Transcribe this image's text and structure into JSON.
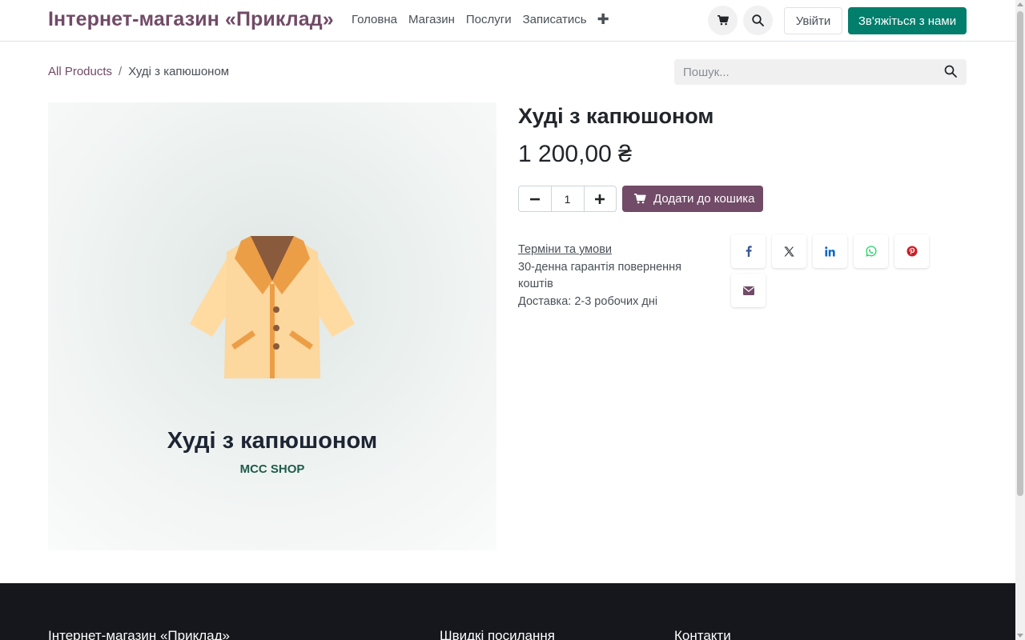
{
  "header": {
    "brand": "Інтернет-магазин «Приклад»",
    "nav": [
      {
        "label": "Головна"
      },
      {
        "label": "Магазин"
      },
      {
        "label": "Послуги"
      },
      {
        "label": "Записатись"
      }
    ],
    "nav_more_icon": "plus-icon",
    "cart_icon": "cart-icon",
    "search_icon": "search-icon",
    "login_label": "Увійти",
    "contact_label": "Зв'яжіться з нами"
  },
  "breadcrumb": {
    "root": "All Products",
    "separator": "/",
    "current": "Худі з капюшоном"
  },
  "search": {
    "placeholder": "Пошук...",
    "value": ""
  },
  "product": {
    "title": "Худі з капюшоном",
    "price": "1 200,00 ₴",
    "quantity": "1",
    "add_to_cart_label": "Додати до кошика",
    "image": {
      "title": "Худі з капюшоном",
      "subtitle": "MCC SHOP"
    },
    "info": {
      "terms": "Терміни та умови",
      "guarantee": "30-денна гарантія повернення коштів",
      "delivery": "Доставка: 2-3 робочих дні"
    },
    "share": [
      "facebook-icon",
      "x-icon",
      "linkedin-icon",
      "whatsapp-icon",
      "pinterest-icon",
      "email-icon"
    ]
  },
  "footer": {
    "col1": "Інтернет-магазин «Приклад»",
    "col2": "Швидкі посилання",
    "col3": "Контакти"
  },
  "colors": {
    "brand": "#714b67",
    "accent": "#017e6c",
    "footer_bg": "#15171c"
  }
}
